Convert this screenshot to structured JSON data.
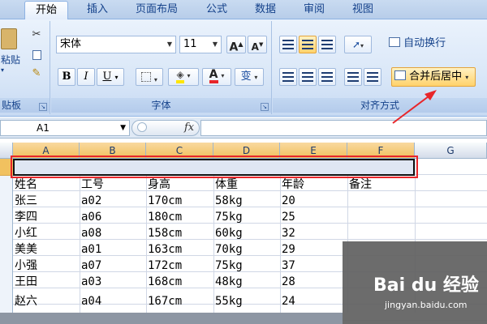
{
  "tabs": [
    {
      "label": "开始",
      "active": true
    },
    {
      "label": "插入"
    },
    {
      "label": "页面布局"
    },
    {
      "label": "公式"
    },
    {
      "label": "数据"
    },
    {
      "label": "审阅"
    },
    {
      "label": "视图"
    }
  ],
  "ribbon": {
    "clipboard": {
      "paste_label": "粘贴",
      "group_label": "贴板"
    },
    "font": {
      "font_name": "宋体",
      "font_size": "11",
      "grow_label": "A",
      "shrink_label": "A",
      "bold": "B",
      "italic": "I",
      "underline": "U",
      "font_color_label": "A",
      "phonetic_label": "变",
      "group_label": "字体"
    },
    "alignment": {
      "wrap_label": "自动换行",
      "merge_label": "合并后居中",
      "group_label": "对齐方式"
    },
    "colors": {
      "accent": "#15428b",
      "highlight": "#ffd26b",
      "font_red": "#e8262a"
    }
  },
  "formula_bar": {
    "cell_ref": "A1",
    "fx": "fx",
    "value": ""
  },
  "columns": [
    "A",
    "B",
    "C",
    "D",
    "E",
    "F",
    "G"
  ],
  "table": {
    "headers": [
      "姓名",
      "工号",
      "身高",
      "体重",
      "年龄",
      "备注"
    ],
    "rows": [
      [
        "张三",
        "a02",
        "170cm",
        "58kg",
        "20"
      ],
      [
        "李四",
        "a06",
        "180cm",
        "75kg",
        "25"
      ],
      [
        "小红",
        "a08",
        "158cm",
        "60kg",
        "32"
      ],
      [
        "美美",
        "a01",
        "163cm",
        "70kg",
        "29"
      ],
      [
        "小强",
        "a07",
        "172cm",
        "75kg",
        "37"
      ],
      [
        "王田",
        "a03",
        "168cm",
        "48kg",
        "28"
      ],
      [
        "赵六",
        "a04",
        "167cm",
        "55kg",
        "24"
      ]
    ]
  },
  "watermark": {
    "brand": "Bai du 经验",
    "url": "jingyan.baidu.com"
  },
  "annotation_colors": {
    "box": "#e8262a",
    "arrow": "#e8262a"
  }
}
